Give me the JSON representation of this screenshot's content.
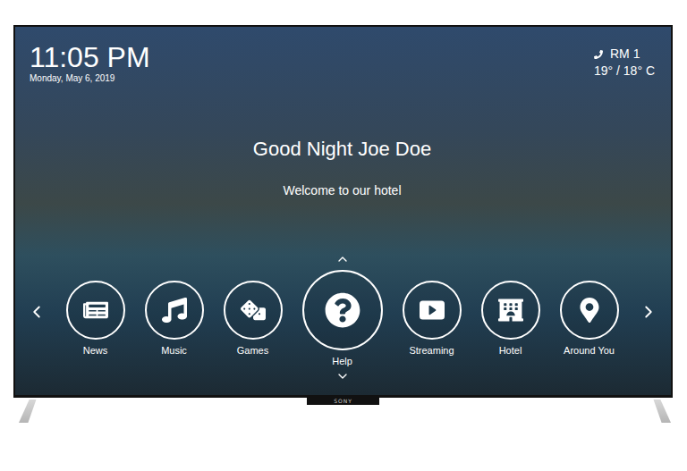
{
  "clock": {
    "time": "11:05 PM",
    "date": "Monday, May 6, 2019"
  },
  "room": {
    "label": "RM 1",
    "temperature": "19° / 18° C"
  },
  "greeting": "Good Night Joe Doe",
  "welcome": "Welcome to our hotel",
  "menu": [
    {
      "label": "News",
      "selected": false
    },
    {
      "label": "Music",
      "selected": false
    },
    {
      "label": "Games",
      "selected": false
    },
    {
      "label": "Help",
      "selected": true
    },
    {
      "label": "Streaming",
      "selected": false
    },
    {
      "label": "Hotel",
      "selected": false
    },
    {
      "label": "Around You",
      "selected": false
    }
  ],
  "brand": "SONY"
}
